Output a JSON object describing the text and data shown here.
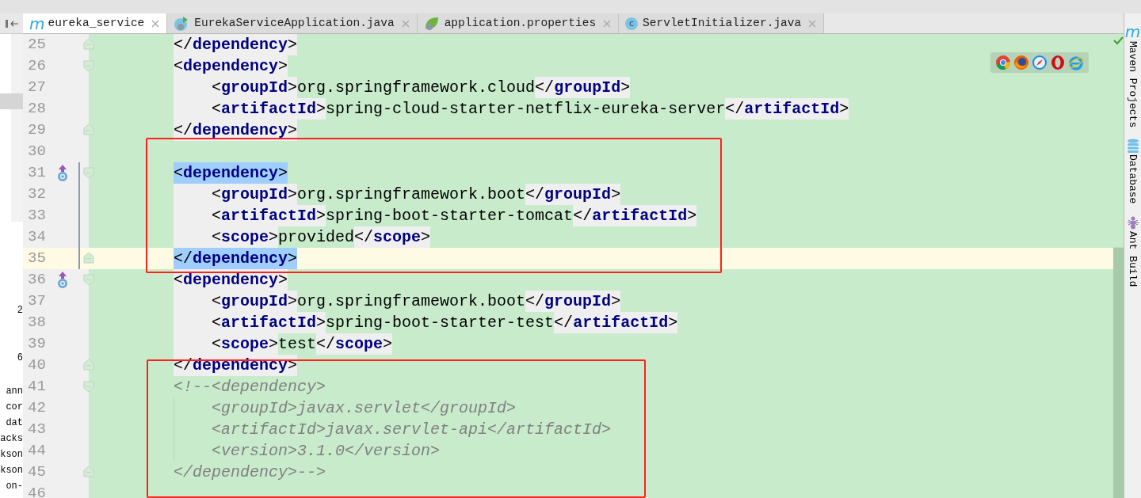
{
  "left_panel": {
    "fragments": [
      "2",
      "6",
      "ann",
      "cor",
      "dat",
      "acks",
      "kson",
      "kson",
      "on-"
    ]
  },
  "tabs": [
    {
      "label": "eureka_service",
      "kind": "maven",
      "badge": "m",
      "selected": true
    },
    {
      "label": "EurekaServiceApplication.java",
      "kind": "spring-boot",
      "selected": false
    },
    {
      "label": "application.properties",
      "kind": "leaf",
      "selected": false
    },
    {
      "label": "ServletInitializer.java",
      "kind": "class",
      "badge": "c",
      "selected": false
    }
  ],
  "editor": {
    "inspection_ok": true,
    "browser_icons": [
      {
        "kind": "chrome"
      },
      {
        "kind": "firefox"
      },
      {
        "kind": "safari"
      },
      {
        "kind": "opera"
      },
      {
        "kind": "ie"
      }
    ],
    "highlight_boxes": [
      {
        "color": "#ff2020"
      },
      {
        "color": "#ff2020"
      }
    ],
    "lines": [
      {
        "number": "25",
        "fold_end": true,
        "nested": false,
        "tokens": [
          {
            "kind": "punct",
            "text": "</"
          },
          {
            "kind": "name",
            "text": "dependency"
          },
          {
            "kind": "punct",
            "text": ">"
          }
        ]
      },
      {
        "number": "26",
        "fold_start": true,
        "nested": false,
        "tokens": [
          {
            "kind": "punct",
            "text": "<"
          },
          {
            "kind": "name",
            "text": "dependency"
          },
          {
            "kind": "punct",
            "text": ">"
          }
        ]
      },
      {
        "number": "27",
        "nested": true,
        "tokens": [
          {
            "kind": "punct",
            "text": "<"
          },
          {
            "kind": "name",
            "text": "groupId"
          },
          {
            "kind": "punct",
            "text": ">"
          },
          {
            "kind": "text",
            "text": "org.springframework.cloud"
          },
          {
            "kind": "punct",
            "text": "</"
          },
          {
            "kind": "name",
            "text": "groupId"
          },
          {
            "kind": "punct",
            "text": ">"
          }
        ]
      },
      {
        "number": "28",
        "nested": true,
        "tokens": [
          {
            "kind": "punct",
            "text": "<"
          },
          {
            "kind": "name",
            "text": "artifactId"
          },
          {
            "kind": "punct",
            "text": ">"
          },
          {
            "kind": "text",
            "text": "spring-cloud-starter-netflix-eureka-server"
          },
          {
            "kind": "punct",
            "text": "</"
          },
          {
            "kind": "name",
            "text": "artifactId"
          },
          {
            "kind": "punct",
            "text": ">"
          }
        ]
      },
      {
        "number": "29",
        "fold_end": true,
        "nested": false,
        "tokens": [
          {
            "kind": "punct",
            "text": "</"
          },
          {
            "kind": "name",
            "text": "dependency"
          },
          {
            "kind": "punct",
            "text": ">"
          }
        ]
      },
      {
        "number": "30"
      },
      {
        "number": "31",
        "fold_start": true,
        "override_marker": true,
        "changed": true,
        "selected": true,
        "nested": false,
        "tokens": [
          {
            "kind": "punct",
            "text": "<"
          },
          {
            "kind": "name",
            "text": "dependency"
          },
          {
            "kind": "punct",
            "text": ">"
          }
        ]
      },
      {
        "number": "32",
        "changed": true,
        "nested": true,
        "tokens": [
          {
            "kind": "punct",
            "text": "<"
          },
          {
            "kind": "name",
            "text": "groupId"
          },
          {
            "kind": "punct",
            "text": ">"
          },
          {
            "kind": "text",
            "text": "org.springframework.boot"
          },
          {
            "kind": "punct",
            "text": "</"
          },
          {
            "kind": "name",
            "text": "groupId"
          },
          {
            "kind": "punct",
            "text": ">"
          }
        ]
      },
      {
        "number": "33",
        "changed": true,
        "nested": true,
        "tokens": [
          {
            "kind": "punct",
            "text": "<"
          },
          {
            "kind": "name",
            "text": "artifactId"
          },
          {
            "kind": "punct",
            "text": ">"
          },
          {
            "kind": "text",
            "text": "spring-boot-starter-tomcat"
          },
          {
            "kind": "punct",
            "text": "</"
          },
          {
            "kind": "name",
            "text": "artifactId"
          },
          {
            "kind": "punct",
            "text": ">"
          }
        ]
      },
      {
        "number": "34",
        "changed": true,
        "nested": true,
        "tokens": [
          {
            "kind": "punct",
            "text": "<"
          },
          {
            "kind": "name",
            "text": "scope"
          },
          {
            "kind": "punct",
            "text": ">"
          },
          {
            "kind": "text",
            "text": "provided"
          },
          {
            "kind": "punct",
            "text": "</"
          },
          {
            "kind": "name",
            "text": "scope"
          },
          {
            "kind": "punct",
            "text": ">"
          }
        ]
      },
      {
        "number": "35",
        "fold_end": true,
        "changed": true,
        "current": true,
        "selected": true,
        "nested": false,
        "tokens": [
          {
            "kind": "punct",
            "text": "</"
          },
          {
            "kind": "name",
            "text": "dependency"
          },
          {
            "kind": "punct",
            "text": ">"
          }
        ]
      },
      {
        "number": "36",
        "fold_start": true,
        "override_marker": true,
        "nested": false,
        "tokens": [
          {
            "kind": "punct",
            "text": "<"
          },
          {
            "kind": "name",
            "text": "dependency"
          },
          {
            "kind": "punct",
            "text": ">"
          }
        ]
      },
      {
        "number": "37",
        "nested": true,
        "tokens": [
          {
            "kind": "punct",
            "text": "<"
          },
          {
            "kind": "name",
            "text": "groupId"
          },
          {
            "kind": "punct",
            "text": ">"
          },
          {
            "kind": "text",
            "text": "org.springframework.boot"
          },
          {
            "kind": "punct",
            "text": "</"
          },
          {
            "kind": "name",
            "text": "groupId"
          },
          {
            "kind": "punct",
            "text": ">"
          }
        ]
      },
      {
        "number": "38",
        "nested": true,
        "tokens": [
          {
            "kind": "punct",
            "text": "<"
          },
          {
            "kind": "name",
            "text": "artifactId"
          },
          {
            "kind": "punct",
            "text": ">"
          },
          {
            "kind": "text",
            "text": "spring-boot-starter-test"
          },
          {
            "kind": "punct",
            "text": "</"
          },
          {
            "kind": "name",
            "text": "artifactId"
          },
          {
            "kind": "punct",
            "text": ">"
          }
        ]
      },
      {
        "number": "39",
        "nested": true,
        "tokens": [
          {
            "kind": "punct",
            "text": "<"
          },
          {
            "kind": "name",
            "text": "scope"
          },
          {
            "kind": "punct",
            "text": ">"
          },
          {
            "kind": "text",
            "text": "test"
          },
          {
            "kind": "punct",
            "text": "</"
          },
          {
            "kind": "name",
            "text": "scope"
          },
          {
            "kind": "punct",
            "text": ">"
          }
        ]
      },
      {
        "number": "40",
        "fold_end": true,
        "nested": false,
        "tokens": [
          {
            "kind": "punct",
            "text": "</"
          },
          {
            "kind": "name",
            "text": "dependency"
          },
          {
            "kind": "punct",
            "text": ">"
          }
        ]
      },
      {
        "number": "41",
        "fold_start": true,
        "nested": false,
        "tokens": [
          {
            "kind": "comment",
            "text": "<!--<dependency>"
          }
        ]
      },
      {
        "number": "42",
        "nested": true,
        "tokens": [
          {
            "kind": "comment",
            "text": "<groupId>javax.servlet</groupId>"
          }
        ]
      },
      {
        "number": "43",
        "nested": true,
        "tokens": [
          {
            "kind": "comment",
            "text": "<artifactId>javax.servlet-api</artifactId>"
          }
        ]
      },
      {
        "number": "44",
        "nested": true,
        "tokens": [
          {
            "kind": "comment",
            "text": "<version>3.1.0</version>"
          }
        ]
      },
      {
        "number": "45",
        "fold_end": true,
        "nested": false,
        "tokens": [
          {
            "kind": "comment",
            "text": "</dependency>-->"
          }
        ]
      },
      {
        "number": "46"
      }
    ]
  },
  "tool_stripe": [
    {
      "kind": "maven",
      "badge": "m",
      "label": "Maven Projects"
    },
    {
      "kind": "database",
      "label": "Database"
    },
    {
      "kind": "ant",
      "label": "Ant Build"
    }
  ]
}
